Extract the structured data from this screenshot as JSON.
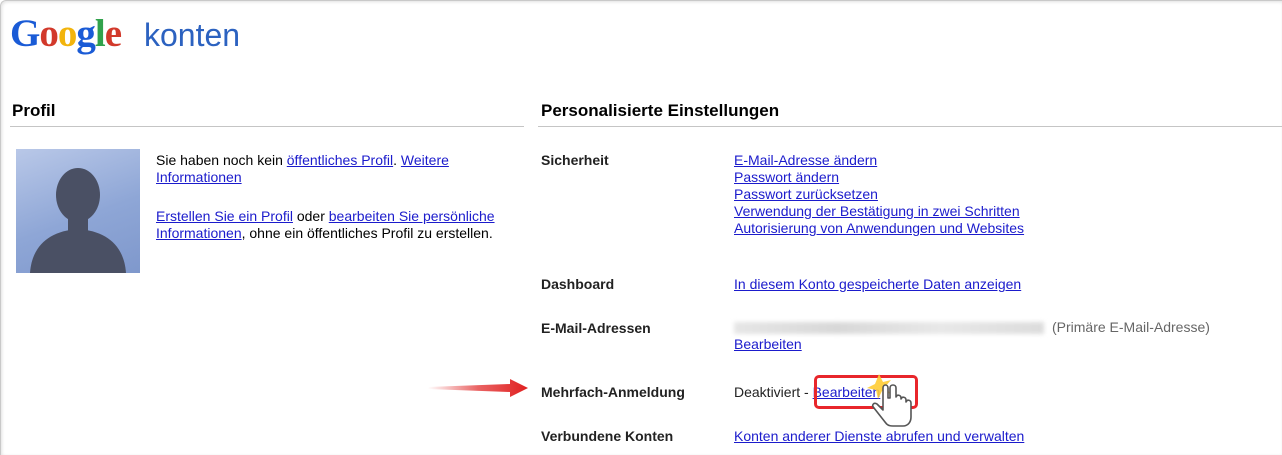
{
  "header": {
    "logo_letters": [
      {
        "ch": "G",
        "color": "#1a5bd6"
      },
      {
        "ch": "o",
        "color": "#d2392b"
      },
      {
        "ch": "o",
        "color": "#f2b40c"
      },
      {
        "ch": "g",
        "color": "#1a5bd6"
      },
      {
        "ch": "l",
        "color": "#31a24c"
      },
      {
        "ch": "e",
        "color": "#d2392b"
      }
    ],
    "subtitle": "konten"
  },
  "profile": {
    "heading": "Profil",
    "line1_prefix": "Sie haben noch kein ",
    "line1_link": "öffentliches Profil",
    "line1_sep": ". ",
    "line1_more_link": "Weitere Informationen",
    "line2_link1": "Erstellen Sie ein Profil",
    "line2_mid": " oder ",
    "line2_link2": "bearbeiten Sie persönliche Informationen",
    "line2_suffix": ", ohne ein öffentliches Profil zu erstellen."
  },
  "settings": {
    "heading": "Personalisierte Einstellungen",
    "security": {
      "label": "Sicherheit",
      "links": [
        "E-Mail-Adresse ändern",
        "Passwort ändern",
        "Passwort zurücksetzen",
        "Verwendung der Bestätigung in zwei Schritten",
        "Autorisierung von Anwendungen und Websites"
      ]
    },
    "dashboard": {
      "label": "Dashboard",
      "link": "In diesem Konto gespeicherte Daten anzeigen"
    },
    "email": {
      "label": "E-Mail-Adressen",
      "note": "(Primäre E-Mail-Adresse)",
      "edit_link": "Bearbeiten"
    },
    "multi_login": {
      "label": "Mehrfach-Anmeldung",
      "status": "Deaktiviert",
      "sep": " - ",
      "edit_link": "Bearbeiten"
    },
    "connected": {
      "label": "Verbundene Konten",
      "link": "Konten anderer Dienste abrufen und verwalten"
    }
  },
  "colors": {
    "link": "#1b1bcc",
    "highlight": "#e8262b",
    "arrow": "#e02020"
  }
}
